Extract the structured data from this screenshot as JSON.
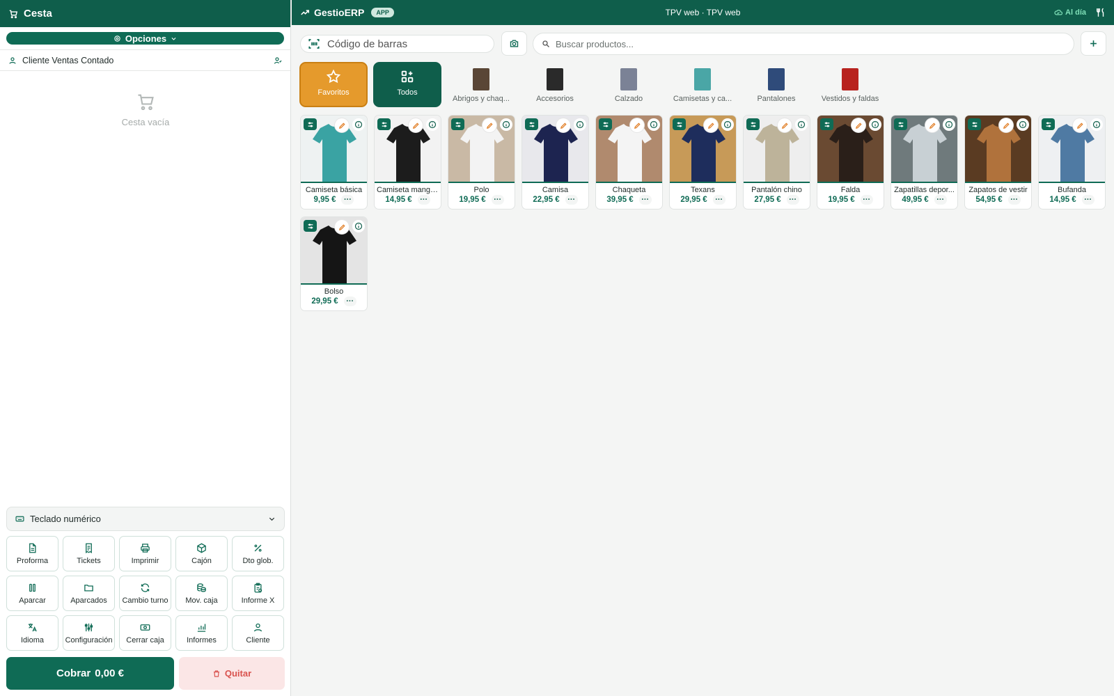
{
  "basket": {
    "title": "Cesta",
    "options_label": "Opciones",
    "customer": "Cliente Ventas Contado",
    "empty_text": "Cesta vacía",
    "numpad_label": "Teclado numérico",
    "checkout_label": "Cobrar",
    "checkout_total": "0,00 €",
    "remove_label": "Quitar"
  },
  "actions": [
    {
      "label": "Proforma",
      "icon": "document-icon"
    },
    {
      "label": "Tickets",
      "icon": "receipt-icon"
    },
    {
      "label": "Imprimir",
      "icon": "printer-icon"
    },
    {
      "label": "Cajón",
      "icon": "box-icon"
    },
    {
      "label": "Dto glob.",
      "icon": "percent-icon"
    },
    {
      "label": "Aparcar",
      "icon": "pause-icon"
    },
    {
      "label": "Aparcados",
      "icon": "folder-icon"
    },
    {
      "label": "Cambio turno",
      "icon": "refresh-icon"
    },
    {
      "label": "Mov. caja",
      "icon": "coins-icon"
    },
    {
      "label": "Informe X",
      "icon": "clipboard-icon"
    },
    {
      "label": "Idioma",
      "icon": "translate-icon"
    },
    {
      "label": "Configuración",
      "icon": "sliders-icon"
    },
    {
      "label": "Cerrar caja",
      "icon": "cash-icon"
    },
    {
      "label": "Informes",
      "icon": "bar-chart-icon"
    },
    {
      "label": "Cliente",
      "icon": "user-icon"
    }
  ],
  "topbar": {
    "brand": "GestioERP",
    "badge": "APP",
    "title": "TPV web · TPV web",
    "status": "Al día"
  },
  "barcode": {
    "placeholder": "Código de barras"
  },
  "search": {
    "placeholder": "Buscar productos..."
  },
  "categories": [
    {
      "label": "Favoritos",
      "kind": "fav"
    },
    {
      "label": "Todos",
      "kind": "all"
    },
    {
      "label": "Abrigos y chaq...",
      "kind": "thumb",
      "color": "#5a4636"
    },
    {
      "label": "Accesorios",
      "kind": "thumb",
      "color": "#2a2a2a"
    },
    {
      "label": "Calzado",
      "kind": "thumb",
      "color": "#7b8296"
    },
    {
      "label": "Camisetas y ca...",
      "kind": "thumb",
      "color": "#4aa6a6"
    },
    {
      "label": "Pantalones",
      "kind": "thumb",
      "color": "#2f4b7a"
    },
    {
      "label": "Vestidos y faldas",
      "kind": "thumb",
      "color": "#b8231f"
    }
  ],
  "products": [
    {
      "name": "Camiseta básica",
      "price": "9,95 €",
      "color": "#3aa3a3",
      "bg": "#eef2f2"
    },
    {
      "name": "Camiseta manga...",
      "price": "14,95 €",
      "color": "#1c1c1c",
      "bg": "#f2f2f2"
    },
    {
      "name": "Polo",
      "price": "19,95 €",
      "color": "#f3f3f3",
      "bg": "#c9b9a5"
    },
    {
      "name": "Camisa",
      "price": "22,95 €",
      "color": "#1d2450",
      "bg": "#e8e8ec"
    },
    {
      "name": "Chaqueta",
      "price": "39,95 €",
      "color": "#f4f4f4",
      "bg": "#b08a6e"
    },
    {
      "name": "Texans",
      "price": "29,95 €",
      "color": "#1e2d5c",
      "bg": "#c79a58"
    },
    {
      "name": "Pantalón chino",
      "price": "27,95 €",
      "color": "#bdb39a",
      "bg": "#eeeeee"
    },
    {
      "name": "Falda",
      "price": "19,95 €",
      "color": "#2a1f19",
      "bg": "#6a4a32"
    },
    {
      "name": "Zapatillas depor...",
      "price": "49,95 €",
      "color": "#c8d0d4",
      "bg": "#6f7a7c"
    },
    {
      "name": "Zapatos de vestir",
      "price": "54,95 €",
      "color": "#b0723c",
      "bg": "#5a3b22"
    },
    {
      "name": "Bufanda",
      "price": "14,95 €",
      "color": "#4f7aa3",
      "bg": "#eef0f2"
    },
    {
      "name": "Bolso",
      "price": "29,95 €",
      "color": "#151515",
      "bg": "#e4e4e4"
    }
  ],
  "colors": {
    "primary": "#0f6b55",
    "header": "#0f5e4b",
    "favorite": "#e59a2c",
    "danger": "#d9534f"
  }
}
